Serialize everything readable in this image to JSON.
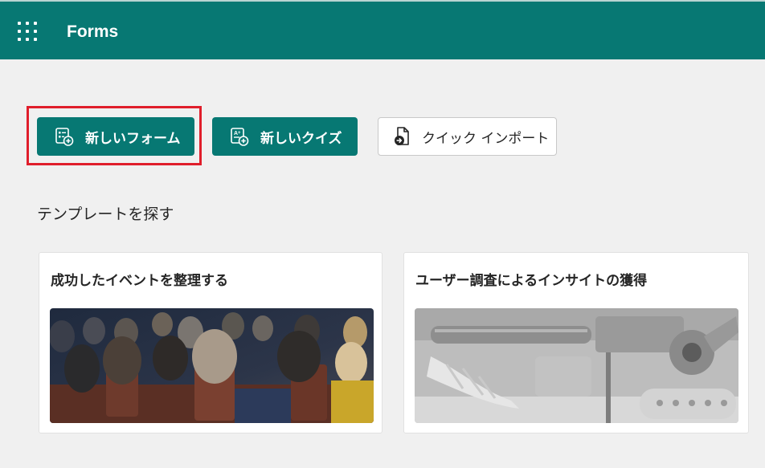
{
  "header": {
    "app_title": "Forms",
    "waffle_icon": "app-launcher-icon",
    "background_color": "#077873"
  },
  "actions": {
    "new_form_label": "新しいフォーム",
    "new_form_icon": "new-form-icon",
    "new_quiz_label": "新しいクイズ",
    "new_quiz_icon": "new-quiz-icon",
    "quick_import_label": "クイック インポート",
    "quick_import_icon": "import-file-icon",
    "highlight_color": "#e01e2b"
  },
  "templates": {
    "section_title": "テンプレートを探す",
    "cards": [
      {
        "title": "成功したイベントを整理する",
        "image": "audience-in-theater-seats"
      },
      {
        "title": "ユーザー調査によるインサイトの獲得",
        "image": "3d-printed-mechanical-parts"
      }
    ]
  }
}
